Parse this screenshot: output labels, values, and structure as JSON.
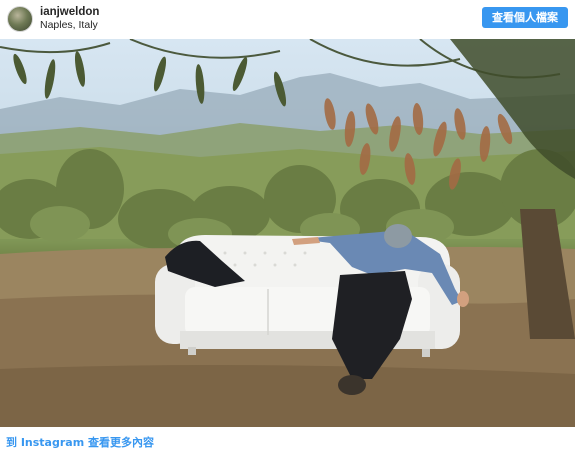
{
  "header": {
    "avatar": "profile-avatar",
    "username": "ianjweldon",
    "location": "Naples, Italy",
    "profile_button": "查看個人檔案"
  },
  "photo": {
    "subject": "man-lying-on-white-sofa-in-olive-grove"
  },
  "footer": {
    "link_text": "到 Instagram 查看更多內容"
  },
  "colors": {
    "accent": "#3897f0",
    "text": "#262626",
    "background": "#ffffff"
  }
}
